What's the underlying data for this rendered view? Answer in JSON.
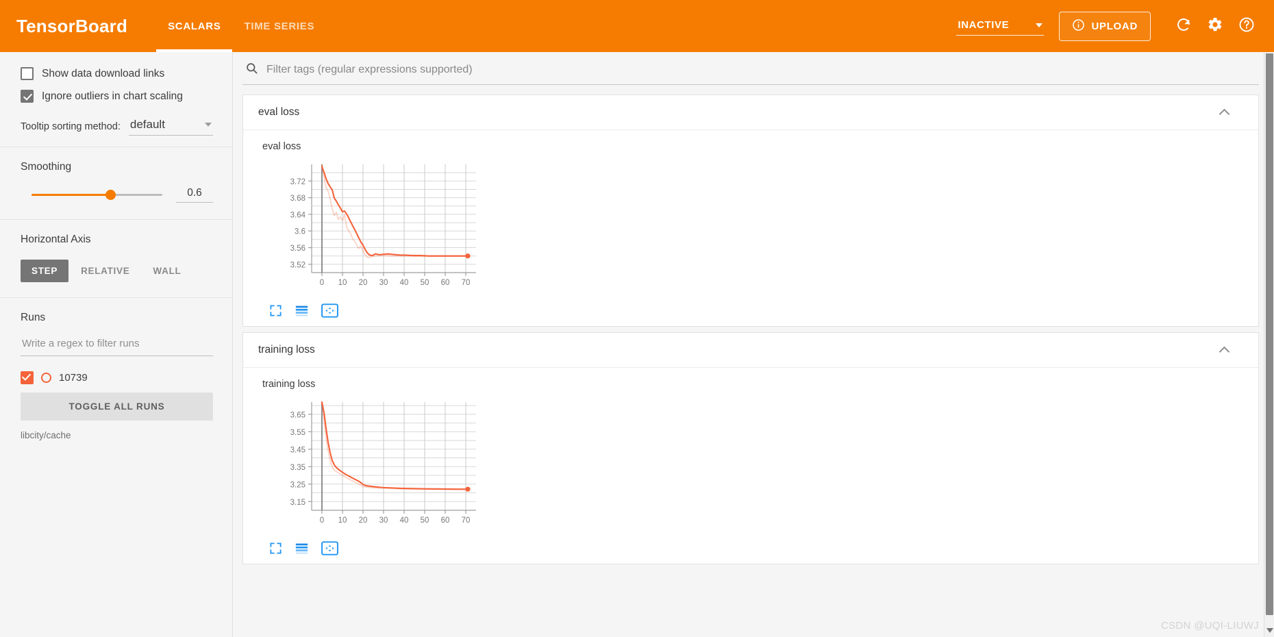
{
  "header": {
    "brand": "TensorBoard",
    "tabs": [
      {
        "label": "SCALARS",
        "active": true
      },
      {
        "label": "TIME SERIES",
        "active": false
      }
    ],
    "run_selector": "INACTIVE",
    "upload_label": "UPLOAD",
    "icons": {
      "info": "info-icon",
      "refresh": "refresh-icon",
      "settings": "gear-icon",
      "help": "help-icon"
    },
    "accent_color": "#f57c00"
  },
  "sidebar": {
    "show_download_links": {
      "label": "Show data download links",
      "checked": false
    },
    "ignore_outliers": {
      "label": "Ignore outliers in chart scaling",
      "checked": true
    },
    "tooltip_sorting": {
      "label": "Tooltip sorting method:",
      "value": "default"
    },
    "smoothing": {
      "label": "Smoothing",
      "value": "0.6",
      "percent": 60
    },
    "horizontal_axis": {
      "label": "Horizontal Axis",
      "options": [
        "STEP",
        "RELATIVE",
        "WALL"
      ],
      "selected": "STEP"
    },
    "runs": {
      "label": "Runs",
      "filter_placeholder": "Write a regex to filter runs",
      "filter_value": "",
      "items": [
        {
          "name": "10739",
          "checked": true,
          "color": "#f4633a"
        }
      ],
      "toggle_all_label": "TOGGLE ALL RUNS",
      "logdir": "libcity/cache"
    }
  },
  "main": {
    "filter_placeholder": "Filter tags (regular expressions supported)",
    "filter_value": "",
    "cards": [
      {
        "header": "eval loss",
        "chart_index": 0
      },
      {
        "header": "training loss",
        "chart_index": 1
      }
    ],
    "chart_toolbar_icons": [
      "fullscreen-icon",
      "data-series-icon",
      "fit-domain-icon"
    ]
  },
  "watermark": "CSDN @UQI-LIUWJ",
  "chart_data": [
    {
      "type": "line",
      "title": "eval loss",
      "xlabel": "",
      "ylabel": "",
      "xlim": [
        -5,
        75
      ],
      "ylim": [
        3.5,
        3.76
      ],
      "xticks": [
        0,
        10,
        20,
        30,
        40,
        50,
        60,
        70
      ],
      "yticks": [
        3.52,
        3.56,
        3.6,
        3.64,
        3.68,
        3.72
      ],
      "grid": true,
      "legend": "none",
      "series": [
        {
          "name": "10739 (smoothed)",
          "color": "#f4633a",
          "opacity": 1,
          "x": [
            0,
            1,
            2,
            3,
            4,
            5,
            6,
            7,
            8,
            9,
            10,
            11,
            12,
            13,
            14,
            15,
            16,
            17,
            18,
            19,
            20,
            21,
            22,
            23,
            24,
            25,
            26,
            28,
            30,
            32,
            34,
            36,
            38,
            40,
            44,
            48,
            52,
            56,
            60,
            64,
            68,
            71
          ],
          "y": [
            3.755,
            3.741,
            3.726,
            3.714,
            3.706,
            3.699,
            3.679,
            3.672,
            3.663,
            3.655,
            3.646,
            3.648,
            3.641,
            3.632,
            3.622,
            3.612,
            3.603,
            3.593,
            3.583,
            3.573,
            3.566,
            3.556,
            3.548,
            3.543,
            3.541,
            3.542,
            3.545,
            3.543,
            3.544,
            3.545,
            3.544,
            3.543,
            3.542,
            3.542,
            3.541,
            3.541,
            3.54,
            3.54,
            3.54,
            3.54,
            3.54,
            3.54
          ]
        },
        {
          "name": "10739 (raw)",
          "color": "#f4633a",
          "opacity": 0.28,
          "x": [
            0,
            1,
            2,
            3,
            4,
            5,
            6,
            7,
            8,
            9,
            10,
            11,
            12,
            13,
            14,
            15,
            16,
            17,
            18,
            19,
            20,
            21,
            22,
            23,
            24,
            26,
            30,
            34,
            38,
            42,
            46,
            50,
            54,
            58,
            62,
            66,
            71
          ],
          "y": [
            3.76,
            3.73,
            3.705,
            3.696,
            3.678,
            3.654,
            3.637,
            3.645,
            3.628,
            3.634,
            3.625,
            3.639,
            3.61,
            3.6,
            3.594,
            3.58,
            3.575,
            3.566,
            3.558,
            3.564,
            3.552,
            3.543,
            3.537,
            3.536,
            3.538,
            3.54,
            3.541,
            3.54,
            3.54,
            3.54,
            3.539,
            3.539,
            3.539,
            3.539,
            3.539,
            3.539,
            3.539
          ]
        }
      ],
      "last_point": {
        "x": 71,
        "y": 3.54,
        "color": "#f4633a"
      }
    },
    {
      "type": "line",
      "title": "training loss",
      "xlabel": "",
      "ylabel": "",
      "xlim": [
        -5,
        75
      ],
      "ylim": [
        3.1,
        3.72
      ],
      "xticks": [
        0,
        10,
        20,
        30,
        40,
        50,
        60,
        70
      ],
      "yticks": [
        3.15,
        3.25,
        3.35,
        3.45,
        3.55,
        3.65
      ],
      "grid": true,
      "legend": "none",
      "series": [
        {
          "name": "10739 (smoothed)",
          "color": "#f4633a",
          "opacity": 1,
          "x": [
            0,
            1,
            2,
            3,
            4,
            5,
            6,
            7,
            8,
            9,
            10,
            11,
            12,
            13,
            14,
            15,
            16,
            17,
            18,
            19,
            20,
            21,
            22,
            24,
            26,
            28,
            30,
            34,
            38,
            42,
            46,
            50,
            54,
            58,
            62,
            66,
            71
          ],
          "y": [
            3.72,
            3.66,
            3.57,
            3.49,
            3.43,
            3.385,
            3.36,
            3.345,
            3.335,
            3.326,
            3.318,
            3.31,
            3.303,
            3.297,
            3.29,
            3.284,
            3.278,
            3.272,
            3.266,
            3.258,
            3.248,
            3.243,
            3.24,
            3.237,
            3.234,
            3.232,
            3.23,
            3.228,
            3.226,
            3.225,
            3.224,
            3.223,
            3.2225,
            3.222,
            3.2215,
            3.221,
            3.221
          ]
        },
        {
          "name": "10739 (raw)",
          "color": "#f4633a",
          "opacity": 0.28,
          "x": [
            0,
            1,
            2,
            3,
            4,
            5,
            6,
            7,
            8,
            9,
            10,
            11,
            12,
            13,
            14,
            15,
            16,
            17,
            18,
            19,
            20,
            22,
            26,
            30,
            36,
            42,
            50,
            60,
            71
          ],
          "y": [
            3.72,
            3.62,
            3.52,
            3.44,
            3.385,
            3.35,
            3.33,
            3.322,
            3.315,
            3.308,
            3.3,
            3.293,
            3.286,
            3.28,
            3.274,
            3.268,
            3.262,
            3.256,
            3.25,
            3.242,
            3.236,
            3.232,
            3.228,
            3.226,
            3.224,
            3.222,
            3.221,
            3.2205,
            3.22
          ]
        }
      ],
      "last_point": {
        "x": 71,
        "y": 3.221,
        "color": "#f4633a"
      }
    }
  ]
}
